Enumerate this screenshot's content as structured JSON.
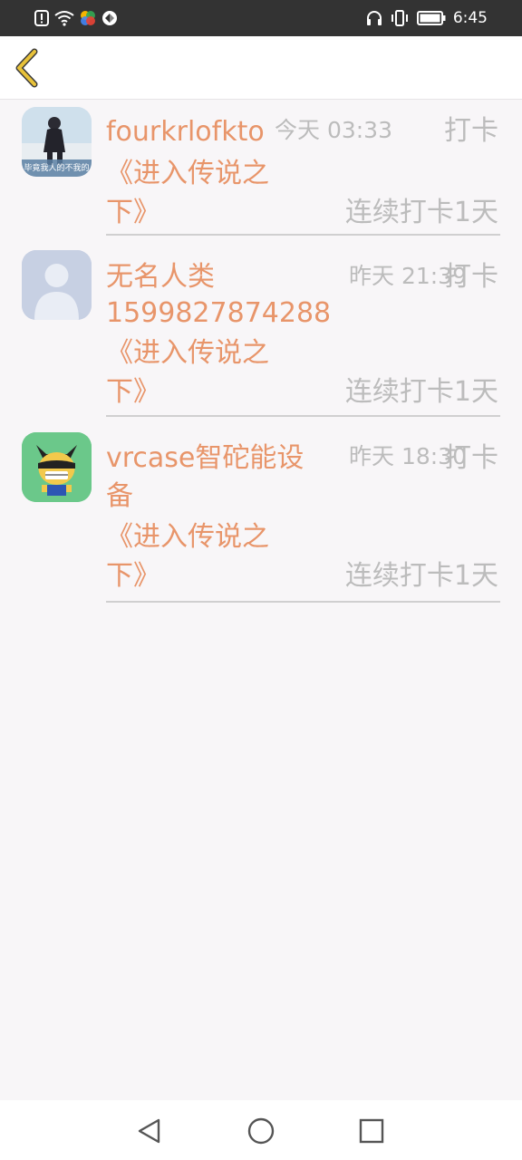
{
  "status_bar": {
    "time": "6:45",
    "left_icons": [
      "alert-icon",
      "wifi-icon",
      "app-icon",
      "app-icon"
    ],
    "right_icons": [
      "headphones-icon",
      "vibrate-icon",
      "battery-icon"
    ]
  },
  "header": {
    "back_icon": "chevron-left-icon",
    "accent_color": "#e8c23a"
  },
  "items": [
    {
      "name_line1": "fourkrlofkto",
      "name_line2": "",
      "time": "今天 03:33",
      "label": "打卡",
      "book_line1": "《进入传说之",
      "book_line2": "下》",
      "streak": "连续打卡1天",
      "avatar_text": "毕竟我人的不我的"
    },
    {
      "name_line1": "无名人类",
      "name_line2": "1599827874288",
      "time": "昨天 21:39",
      "label": "打卡",
      "book_line1": "《进入传说之",
      "book_line2": "下》",
      "streak": "连续打卡1天"
    },
    {
      "name_line1": "vrcase智砣能设",
      "name_line2": "备",
      "time": "昨天 18:30",
      "label": "打卡",
      "book_line1": "《进入传说之",
      "book_line2": "下》",
      "streak": "连续打卡1天"
    }
  ],
  "colors": {
    "name": "#e8956a",
    "muted": "#bcbcbc",
    "background": "#f8f6f8"
  }
}
